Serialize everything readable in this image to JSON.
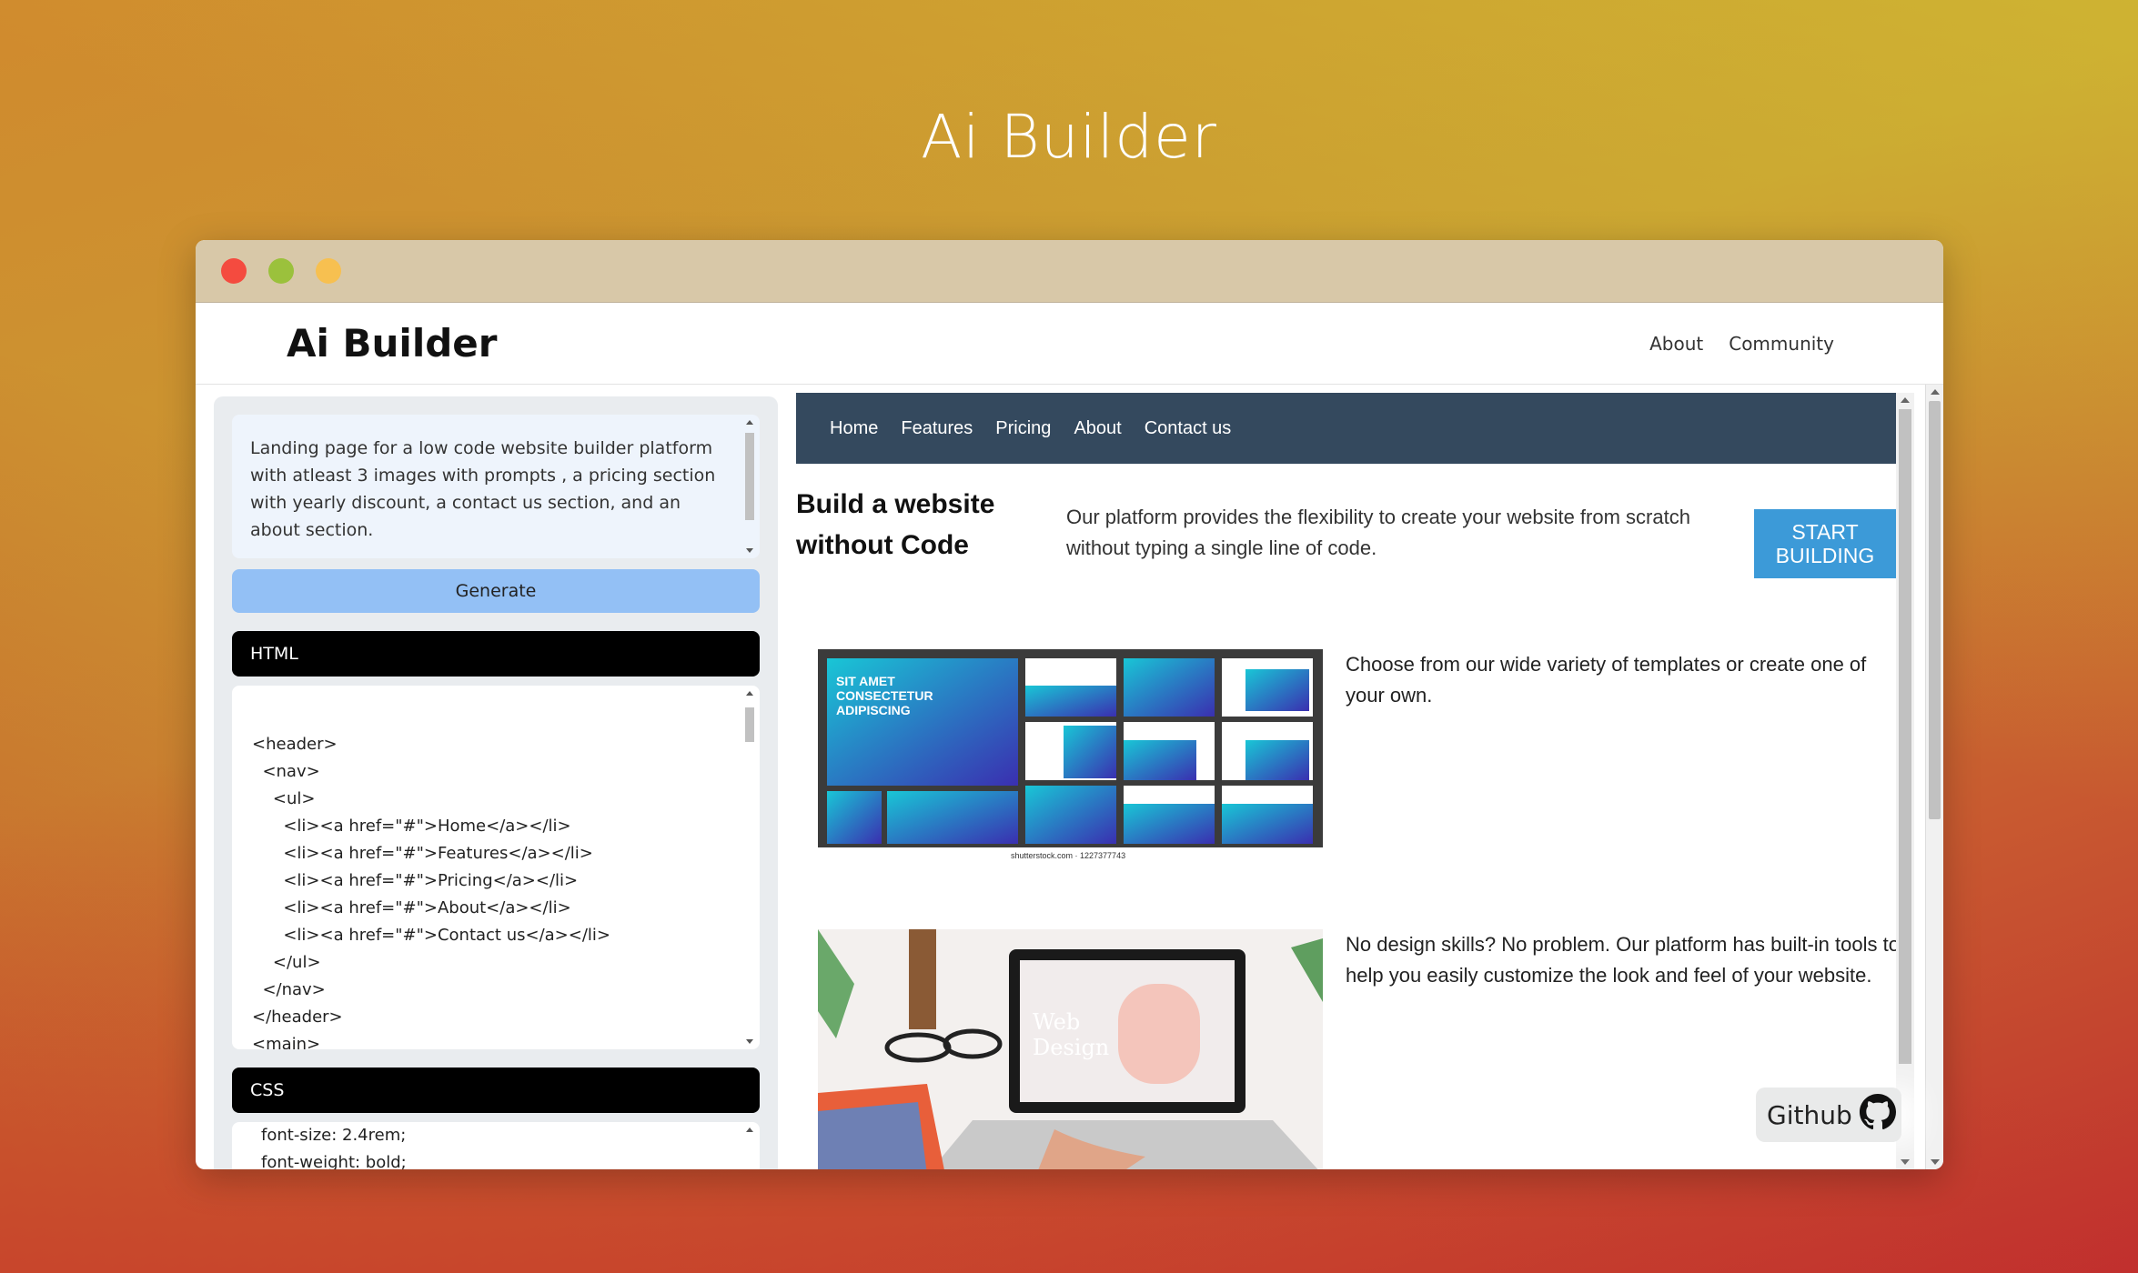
{
  "page": {
    "title": "Ai Builder"
  },
  "window": {
    "controls": [
      "close",
      "minimize",
      "maximize"
    ],
    "app": {
      "brand": "Ai Builder",
      "nav": [
        "About",
        "Community"
      ]
    }
  },
  "editor": {
    "prompt": "Landing page for a low code website builder platform with atleast 3 images with prompts , a pricing section with yearly discount, a contact us section, and an about section.",
    "generate_label": "Generate",
    "html_label": "HTML",
    "html_code": [
      "<header>",
      "  <nav>",
      "    <ul>",
      "      <li><a href=\"#\">Home</a></li>",
      "      <li><a href=\"#\">Features</a></li>",
      "      <li><a href=\"#\">Pricing</a></li>",
      "      <li><a href=\"#\">About</a></li>",
      "      <li><a href=\"#\">Contact us</a></li>",
      "    </ul>",
      "  </nav>",
      "</header>",
      "<main>"
    ],
    "css_label": "CSS",
    "css_code": [
      "font-size: 2.4rem;",
      "font-weight: bold;"
    ]
  },
  "preview": {
    "nav": [
      "Home",
      "Features",
      "Pricing",
      "About",
      "Contact us"
    ],
    "hero": {
      "heading": "Build a website without Code",
      "text": "Our platform provides the flexibility to create your website from scratch without typing a single line of code.",
      "button": "START BUILDING"
    },
    "features": [
      {
        "text": "Choose from our wide variety of templates or create one of your own.",
        "caption": "shutterstock.com · 1227377743"
      },
      {
        "text": "No design skills? No problem. Our platform has built-in tools to help you easily customize the look and feel of your website."
      }
    ]
  },
  "github": {
    "label": "Github"
  },
  "colors": {
    "preview_nav": "#34495e",
    "start_button": "#3c9ad8",
    "generate_button": "#93c0f5",
    "prompt_bg": "#eef4fc"
  }
}
